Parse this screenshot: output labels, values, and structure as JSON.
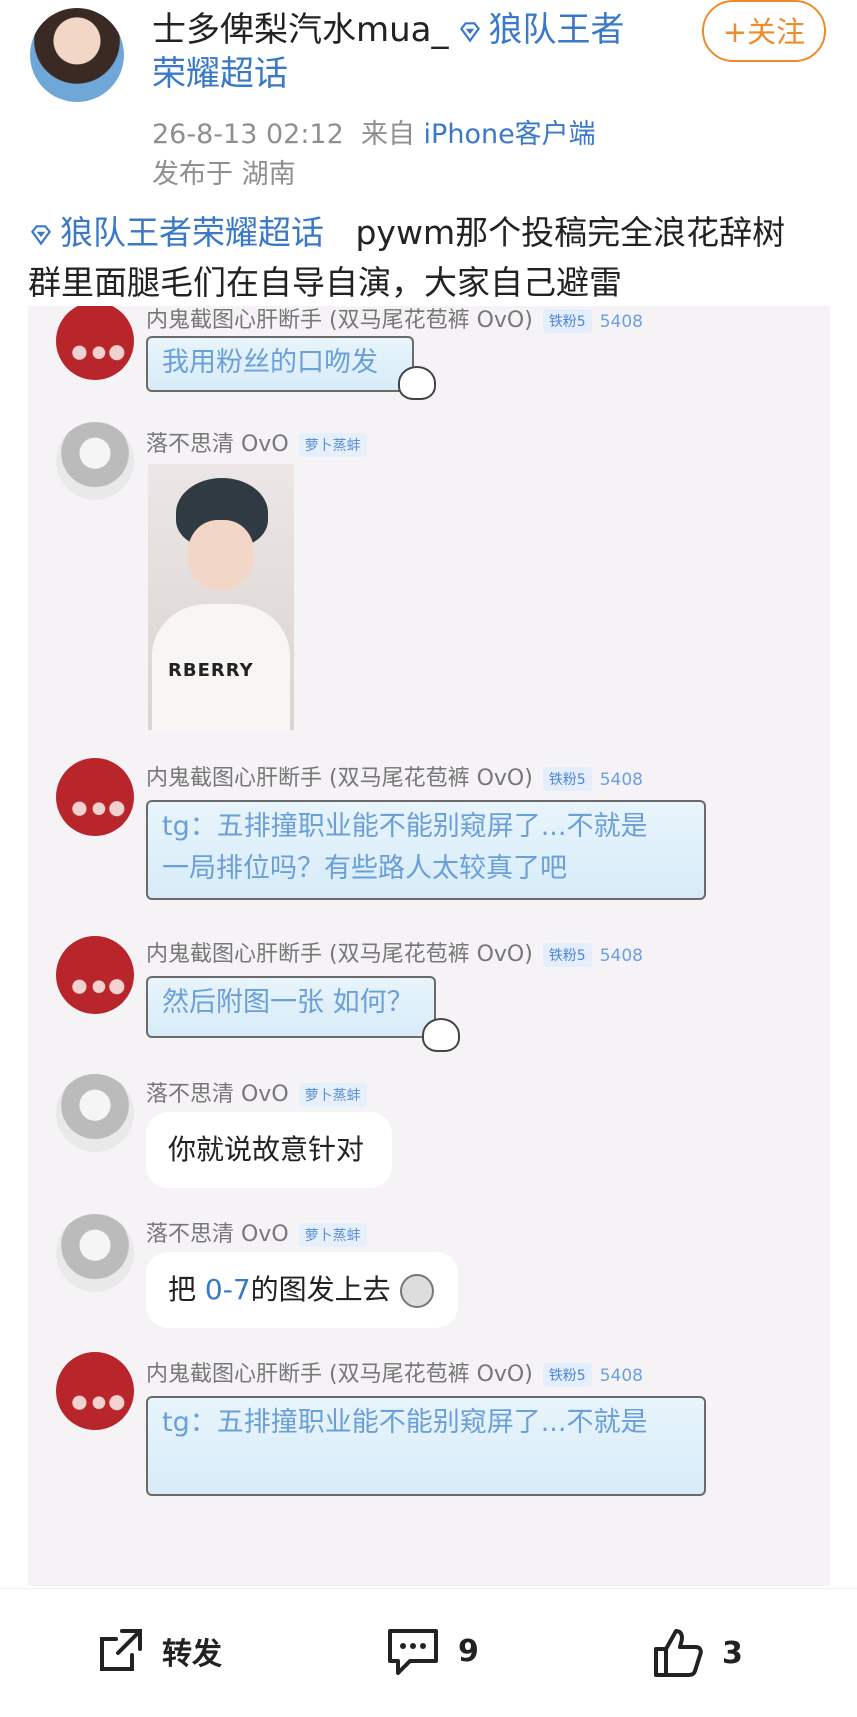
{
  "post": {
    "author": "士多俾梨汽水mua_",
    "author_topic_line1": "狼队王者",
    "author_topic_line2": "荣耀超话",
    "follow_label": "+关注",
    "timestamp": "26-8-13 02:12",
    "from_prefix": "来自",
    "source": "iPhone客户端",
    "location": "发布于 湖南",
    "topic_tag": "狼队王者荣耀超话",
    "body_line1": "pywm那个投稿完全浪花辞树",
    "body_line2": "群里面腿毛们在自导自演，大家自己避雷"
  },
  "chat": {
    "messages": [
      {
        "name": "内鬼截图心肝断手 (双马尾花苞裤 OvO)",
        "badge": "铁粉5",
        "num": "5408",
        "text": "我用粉丝的口吻发"
      },
      {
        "name": "落不思清 OvO",
        "badge": "萝卜蒸蚌"
      },
      {
        "name": "内鬼截图心肝断手 (双马尾花苞裤 OvO)",
        "badge": "铁粉5",
        "num": "5408",
        "text_line1": "tg：五排撞职业能不能别窥屏了...不就是",
        "text_line2": "一局排位吗？有些路人太较真了吧"
      },
      {
        "name": "内鬼截图心肝断手 (双马尾花苞裤 OvO)",
        "badge": "铁粉5",
        "num": "5408",
        "text": "然后附图一张 如何？"
      },
      {
        "name": "落不思清 OvO",
        "badge": "萝卜蒸蚌",
        "text": "你就说故意针对"
      },
      {
        "name": "落不思清 OvO",
        "badge": "萝卜蒸蚌",
        "text_pre": "把 ",
        "text_hl": "0-7",
        "text_post": "的图发上去"
      },
      {
        "name": "内鬼截图心肝断手 (双马尾花苞裤 OvO)",
        "badge": "铁粉5",
        "num": "5408",
        "text": "tg：五排撞职业能不能别窥屏了...不就是"
      }
    ],
    "photo_shirt_text": "RBERRY"
  },
  "actions": {
    "repost_label": "转发",
    "comment_count": "9",
    "like_count": "3"
  },
  "colors": {
    "accent_orange": "#f08a2a",
    "link_blue": "#3a78c8"
  }
}
